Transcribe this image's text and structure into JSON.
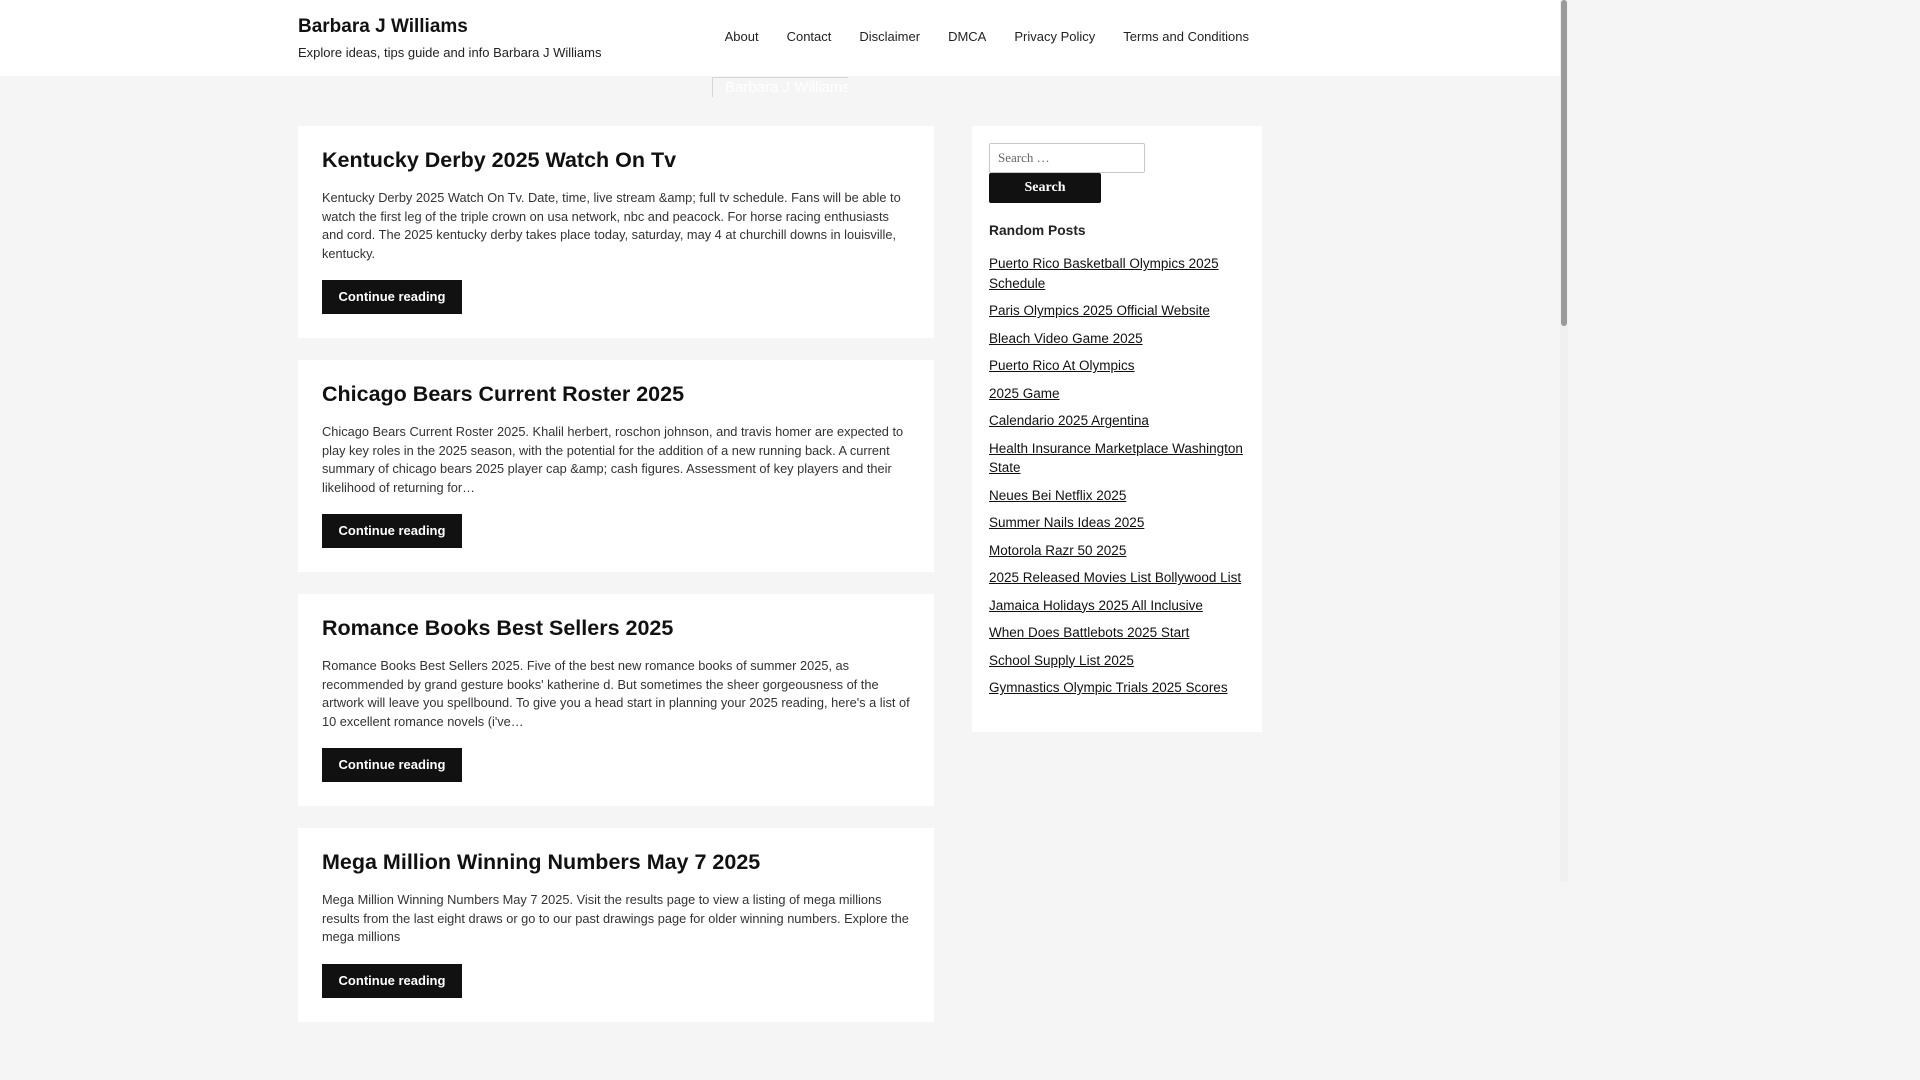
{
  "site": {
    "title": "Barbara J Williams",
    "description": "Explore ideas, tips guide and info Barbara J Williams",
    "header_image_alt": "Barbara J Williams"
  },
  "nav": {
    "items": [
      {
        "label": "About"
      },
      {
        "label": "Contact"
      },
      {
        "label": "Disclaimer"
      },
      {
        "label": "DMCA"
      },
      {
        "label": "Privacy Policy"
      },
      {
        "label": "Terms and Conditions"
      }
    ]
  },
  "posts": [
    {
      "title": "Kentucky Derby 2025 Watch On Tv",
      "excerpt": "Kentucky Derby 2025 Watch On Tv. Date, time, live stream &amp; full tv schedule. Fans will be able to watch the first leg of the triple crown on usa network, nbc and peacock. For horse racing enthusiasts and cord. The 2025 kentucky derby takes place today, saturday, may 4 at churchill downs in louisville, kentucky.",
      "button": "Continue reading"
    },
    {
      "title": "Chicago Bears Current Roster 2025",
      "excerpt": "Chicago Bears Current Roster 2025. Khalil herbert, roschon johnson, and travis homer are expected to play key roles in the 2025 season, with the potential for the addition of a new running back. A current summary of chicago bears 2025 player cap &amp; cash figures. Assessment of key players and their likelihood of returning for…",
      "button": "Continue reading"
    },
    {
      "title": "Romance Books Best Sellers 2025",
      "excerpt": "Romance Books Best Sellers 2025. Five of the best new romance books of summer 2025, as recommended by grand gesture books' katherine d. But sometimes the sheer gorgeousness of the artwork will leave you spellbound. To give you a head start in planning your 2025 reading, here's a list of 10 excellent romance novels (i've…",
      "button": "Continue reading"
    },
    {
      "title": "Mega Million Winning Numbers May 7 2025",
      "excerpt": "Mega Million Winning Numbers May 7 2025. Visit the results page to view a listing of mega millions results from the last eight draws or go to our past drawings page for older winning numbers. Explore the mega millions",
      "button": "Continue reading"
    }
  ],
  "sidebar": {
    "search_placeholder": "Search …",
    "search_button": "Search",
    "widget_title": "Random Posts",
    "random_posts": [
      "Puerto Rico Basketball Olympics 2025 Schedule",
      "Paris Olympics 2025 Official Website",
      "Bleach Video Game 2025",
      "Puerto Rico At Olympics",
      "2025 Game",
      "Calendario 2025 Argentina",
      "Health Insurance Marketplace Washington State",
      "Neues Bei Netflix 2025",
      "Summer Nails Ideas 2025",
      "Motorola Razr 50 2025",
      "2025 Released Movies List Bollywood List",
      "Jamaica Holidays 2025 All Inclusive",
      "When Does Battlebots 2025 Start",
      "School Supply List 2025",
      "Gymnastics Olympic Trials 2025 Scores"
    ]
  }
}
